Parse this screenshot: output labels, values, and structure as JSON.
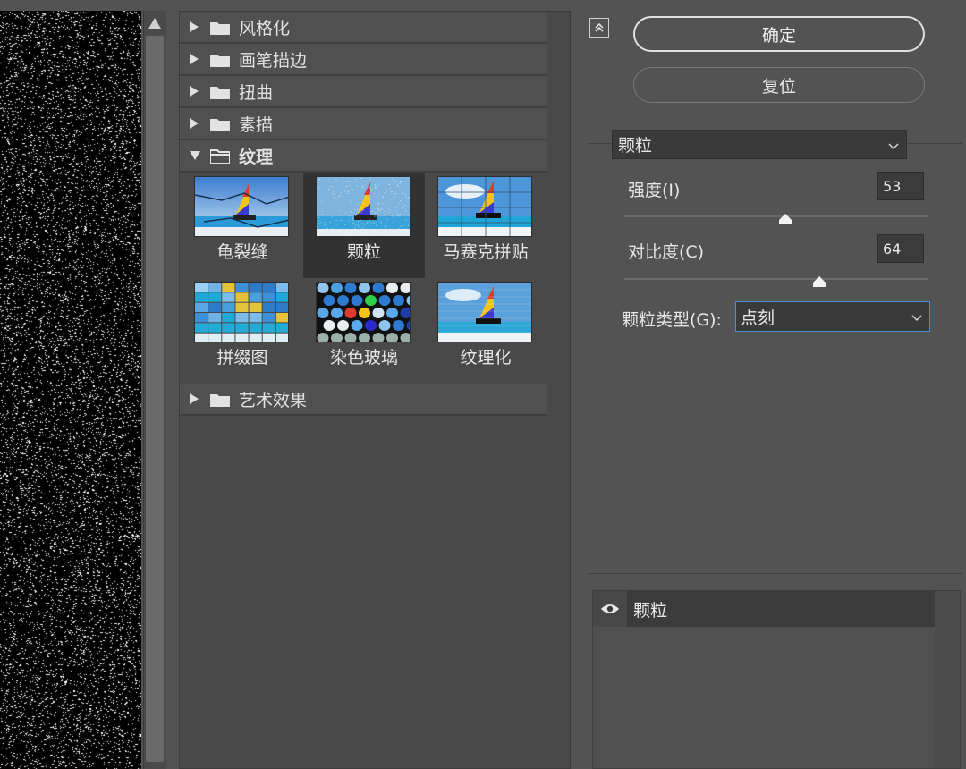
{
  "gallery": {
    "categories": [
      {
        "label": "风格化",
        "expanded": false
      },
      {
        "label": "画笔描边",
        "expanded": false
      },
      {
        "label": "扭曲",
        "expanded": false
      },
      {
        "label": "素描",
        "expanded": false
      },
      {
        "label": "纹理",
        "expanded": true
      },
      {
        "label": "艺术效果",
        "expanded": false
      }
    ],
    "texture_filters": [
      {
        "label": "龟裂缝",
        "selected": false
      },
      {
        "label": "颗粒",
        "selected": true
      },
      {
        "label": "马赛克拼贴",
        "selected": false
      },
      {
        "label": "拼缀图",
        "selected": false
      },
      {
        "label": "染色玻璃",
        "selected": false
      },
      {
        "label": "纹理化",
        "selected": false
      }
    ]
  },
  "buttons": {
    "ok": "确定",
    "reset": "复位"
  },
  "settings": {
    "filter_select": "颗粒",
    "intensity": {
      "label": "强度(I)",
      "value": "53",
      "level": 0.53
    },
    "contrast": {
      "label": "对比度(C)",
      "value": "64",
      "level": 0.64
    },
    "grain_type": {
      "label": "颗粒类型(G):",
      "value": "点刻"
    }
  },
  "layers": {
    "items": [
      {
        "name": "颗粒",
        "visible": true
      }
    ]
  },
  "colors": {
    "panel_bg": "#535353",
    "dark_field": "#3a3a3a",
    "focus_border": "#4a8edb",
    "selected_cell": "#323232"
  },
  "icons": {
    "collapse": "collapse-up-icon",
    "folder": "folder-icon",
    "eye": "eye-icon",
    "chevron": "chevron-down-icon"
  }
}
